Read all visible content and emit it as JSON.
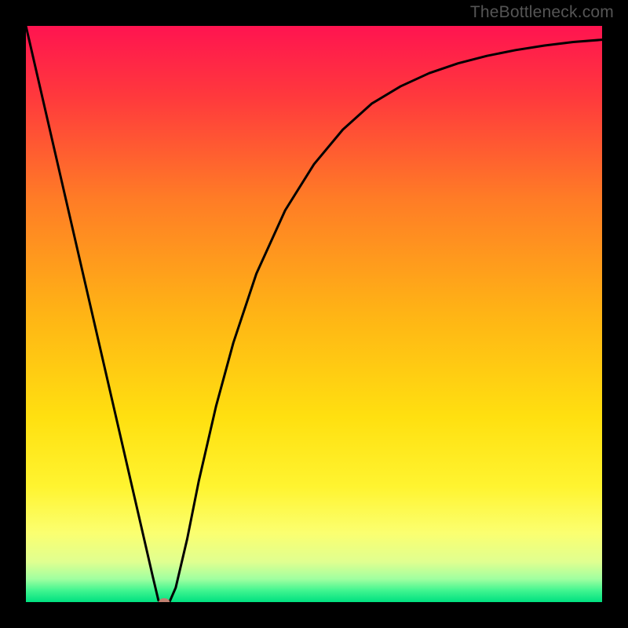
{
  "watermark": "TheBottleneck.com",
  "chart_data": {
    "type": "line",
    "title": "",
    "xlabel": "",
    "ylabel": "",
    "xlim": [
      0,
      100
    ],
    "ylim": [
      0,
      100
    ],
    "background_gradient": {
      "stops": [
        {
          "offset": 0,
          "color": "#ff1450"
        },
        {
          "offset": 12,
          "color": "#ff383d"
        },
        {
          "offset": 30,
          "color": "#ff7c26"
        },
        {
          "offset": 50,
          "color": "#ffb415"
        },
        {
          "offset": 68,
          "color": "#ffe010"
        },
        {
          "offset": 80,
          "color": "#fff430"
        },
        {
          "offset": 88,
          "color": "#fbff70"
        },
        {
          "offset": 93,
          "color": "#e0ff90"
        },
        {
          "offset": 96,
          "color": "#a0ffa0"
        },
        {
          "offset": 98,
          "color": "#40f590"
        },
        {
          "offset": 100,
          "color": "#00e080"
        }
      ]
    },
    "series": [
      {
        "name": "bottleneck-curve",
        "color": "#000000",
        "x": [
          0,
          5,
          10,
          15,
          20,
          22,
          23,
          24,
          25,
          26,
          28,
          30,
          33,
          36,
          40,
          45,
          50,
          55,
          60,
          65,
          70,
          75,
          80,
          85,
          90,
          95,
          100
        ],
        "y": [
          100,
          78.3,
          56.6,
          34.9,
          13.2,
          4.5,
          0.3,
          0,
          0.2,
          2.5,
          11,
          21,
          34,
          45,
          57,
          68,
          76,
          82,
          86.5,
          89.5,
          91.8,
          93.5,
          94.8,
          95.8,
          96.6,
          97.2,
          97.6
        ]
      }
    ],
    "marker": {
      "name": "min-point",
      "x": 24,
      "y": 0,
      "color": "#c08070",
      "rx": 7,
      "ry": 5
    }
  }
}
